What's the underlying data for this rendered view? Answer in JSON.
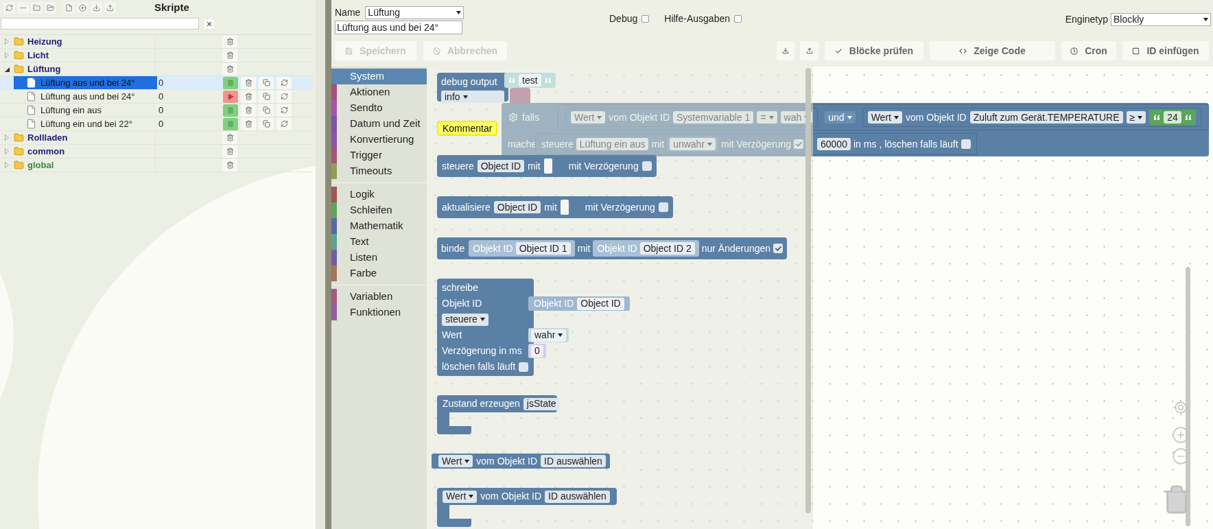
{
  "sidebar": {
    "title": "Skripte"
  },
  "tree": [
    {
      "name": "Heizung",
      "color": "#22207a",
      "expanded": false,
      "selected": false
    },
    {
      "name": "Licht",
      "color": "#22207a",
      "expanded": false,
      "selected": false
    },
    {
      "name": "Lüftung",
      "color": "#22207a",
      "expanded": true,
      "selected": false,
      "children": [
        {
          "name": "Lüftung aus und bei 24°",
          "count": "0",
          "running": true,
          "selected": true
        },
        {
          "name": "Lüftung aus und bei 24°",
          "count": "0",
          "running": false,
          "selected": false
        },
        {
          "name": "Lüftung ein aus",
          "count": "0",
          "running": true,
          "selected": false
        },
        {
          "name": "Lüftung ein und bei 22°",
          "count": "0",
          "running": true,
          "selected": false
        }
      ]
    },
    {
      "name": "Rollladen",
      "color": "#22207a",
      "expanded": false,
      "selected": false
    },
    {
      "name": "common",
      "color": "#22207a",
      "expanded": false,
      "selected": false
    },
    {
      "name": "global",
      "color": "#3a8a3a",
      "expanded": false,
      "selected": false
    }
  ],
  "editor": {
    "name_label": "Name",
    "folder": "Lüftung",
    "script_name": "Lüftung aus und bei 24°",
    "debug": {
      "label": "Debug",
      "checked": false
    },
    "verbose": {
      "label": "Hilfe-Ausgaben",
      "checked": false
    },
    "engine_label": "Enginetyp",
    "engine": "Blockly"
  },
  "toolbar": [
    {
      "kind": "save",
      "label": "Speichern",
      "disabled": true
    },
    {
      "kind": "cancel",
      "label": "Abbrechen",
      "disabled": true
    },
    {
      "kind": "export",
      "disabled": false
    },
    {
      "kind": "import",
      "disabled": false
    },
    {
      "kind": "check",
      "label": "Blöcke prüfen",
      "disabled": false
    },
    {
      "kind": "code",
      "label": "Zeige Code",
      "disabled": false
    },
    {
      "kind": "cron",
      "label": "Cron",
      "disabled": false
    },
    {
      "kind": "insert",
      "label": "ID einfügen",
      "disabled": false
    }
  ],
  "toolbox": [
    {
      "items": [
        {
          "label": "System",
          "color": "#5b87b0",
          "selected": true
        },
        {
          "label": "Aktionen",
          "color": "#a5527a",
          "selected": false
        },
        {
          "label": "Sendto",
          "color": "#a855a8",
          "selected": false
        },
        {
          "label": "Datum und Zeit",
          "color": "#7a55a8",
          "selected": false
        },
        {
          "label": "Konvertierung",
          "color": "#8d55a8",
          "selected": false
        },
        {
          "label": "Trigger",
          "color": "#a5557a",
          "selected": false
        },
        {
          "label": "Timeouts",
          "color": "#8fa055",
          "selected": false
        }
      ]
    },
    {
      "items": [
        {
          "label": "Logik",
          "color": "#a55555",
          "selected": false
        },
        {
          "label": "Schleifen",
          "color": "#5ba55b",
          "selected": false
        },
        {
          "label": "Mathematik",
          "color": "#5b67a5",
          "selected": false
        },
        {
          "label": "Text",
          "color": "#5ba58c",
          "selected": false
        },
        {
          "label": "Listen",
          "color": "#745ba5",
          "selected": false
        },
        {
          "label": "Farbe",
          "color": "#a5745b",
          "selected": false
        }
      ]
    },
    {
      "items": [
        {
          "label": "Variablen",
          "color": "#a55b80",
          "selected": false
        },
        {
          "label": "Funktionen",
          "color": "#995ba5",
          "selected": false
        }
      ]
    }
  ],
  "flyout_blocks": [
    {
      "kind": "debug",
      "label": "debug output",
      "text": "test",
      "severity": "info"
    },
    {
      "kind": "comment",
      "label": "Kommentar"
    },
    {
      "kind": "control",
      "label": "steuere",
      "object": "Object ID",
      "with": "mit",
      "delay_label": "mit Verzögerung",
      "delay": false
    },
    {
      "kind": "control",
      "label": "aktualisiere",
      "object": "Object ID",
      "with": "mit",
      "delay_label": "mit Verzögerung",
      "delay": false
    },
    {
      "kind": "bind",
      "label": "binde",
      "source_label": "Objekt ID",
      "source": "Object ID 1",
      "with": "mit",
      "target_label": "Objekt ID",
      "target": "Object ID 2",
      "changes_label": "nur Änderungen",
      "changes_only": true
    },
    {
      "kind": "write",
      "label": "schreibe",
      "object_label": "Objekt ID",
      "object_block_label": "Objekt ID",
      "object": "Object ID",
      "mode": "steuere",
      "value_label": "Wert",
      "value": "wahr",
      "delay_label": "Verzögerung in ms",
      "delay": "0",
      "clear_label": "löschen falls läuft",
      "clear": false
    },
    {
      "kind": "state",
      "label": "Zustand erzeugen",
      "name": "jsState"
    },
    {
      "kind": "get_value",
      "mode": "Wert",
      "label": "vom Objekt ID",
      "object": "ID auswählen"
    },
    {
      "kind": "on_value",
      "mode": "Wert",
      "label": "vom Objekt ID",
      "object": "ID auswählen"
    }
  ],
  "workspace_block": {
    "if_label": "falls",
    "then_label": "mache",
    "join": "und",
    "conditions": [
      {
        "mode": "Wert",
        "label": "vom Objekt ID",
        "object": "Systemvariable 1",
        "operator": "=",
        "value": "wah",
        "kind": "dropdown"
      },
      {
        "mode": "Wert",
        "label": "vom Objekt ID",
        "object": "Zuluft zum Gerät.TEMPERATURE",
        "operator": "≥",
        "value": "24",
        "kind": "text"
      }
    ],
    "action": {
      "label": "steuere",
      "object": "Lüftung ein aus",
      "with": "mit",
      "value": "unwahr",
      "delay_label": "mit Verzögerung",
      "delay": true,
      "delay_ms": "60000",
      "unit": "in ms",
      "clear_label": ", löschen falls läuft",
      "clear": false
    }
  }
}
